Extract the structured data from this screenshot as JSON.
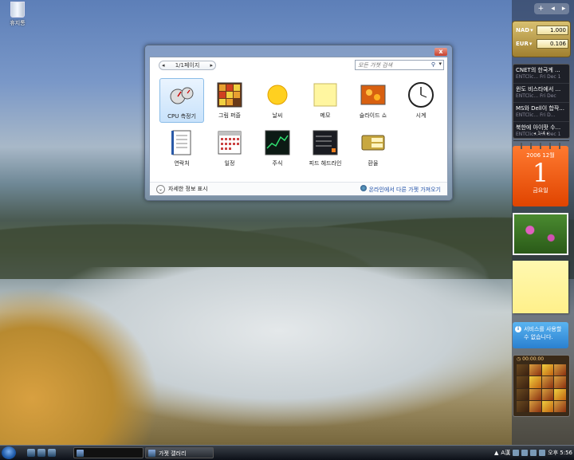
{
  "desktop": {
    "recycle_bin_label": "휴지통"
  },
  "gallery": {
    "pager_label": "1/1페이지",
    "pager_prev": "◂",
    "pager_next": "▸",
    "search_placeholder": "모든 가젯 검색",
    "close_label": "x",
    "gadgets": [
      {
        "label": "CPU 측정기",
        "icon": "cpu-meter-icon",
        "selected": true
      },
      {
        "label": "그림 퍼즐",
        "icon": "picture-puzzle-icon"
      },
      {
        "label": "날씨",
        "icon": "weather-icon"
      },
      {
        "label": "메모",
        "icon": "notes-icon"
      },
      {
        "label": "슬라이드 쇼",
        "icon": "slide-show-icon"
      },
      {
        "label": "시계",
        "icon": "clock-icon"
      },
      {
        "label": "연락처",
        "icon": "contacts-icon"
      },
      {
        "label": "일정",
        "icon": "calendar-icon"
      },
      {
        "label": "주식",
        "icon": "stocks-icon"
      },
      {
        "label": "피드 헤드라인",
        "icon": "feed-headlines-icon"
      },
      {
        "label": "환율",
        "icon": "currency-icon"
      }
    ],
    "details_label": "자세한 정보 표시",
    "online_link": "온라인에서 다른 가젯 가져오기"
  },
  "sidebar": {
    "top_buttons": [
      "+",
      "◂",
      "▸"
    ],
    "currency": {
      "rows": [
        {
          "code": "NAD",
          "value": "1.000"
        },
        {
          "code": "EUR",
          "value": "0.106"
        }
      ]
    },
    "feed": {
      "items": [
        {
          "title": "CNET의 한국계 ...",
          "source": "ENTClic...",
          "date": "Fri Dec 1"
        },
        {
          "title": "윈도 비스타에서 ...",
          "source": "ENTClic...",
          "date": "Fri Dec"
        },
        {
          "title": "MS와 Dell이 합작...",
          "source": "ENTClic...",
          "date": "Fri D..."
        },
        {
          "title": "북한에 아이팟 수...",
          "source": "ENTClic...",
          "date": "Fri Dec 1"
        }
      ],
      "page": "1-4"
    },
    "calendar": {
      "year_month": "2006 12월",
      "day": "1",
      "weekday": "금요일"
    },
    "service_message": "서비스를 사용할 수 없습니다.",
    "puzzle_time": "00:00:00"
  },
  "taskbar": {
    "blurred_window": "",
    "gallery_button": "가젯 갤러리",
    "ime_label": "A漢",
    "clock": "오후 5:56"
  },
  "colors": {
    "accent": "#2050a8",
    "calendar": "#e85510",
    "selection": "#c8e2fb"
  }
}
